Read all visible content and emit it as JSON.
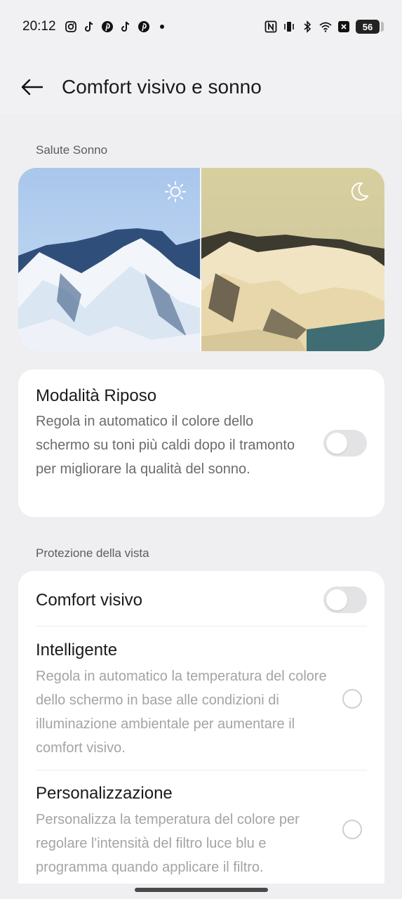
{
  "status_bar": {
    "time": "20:12",
    "battery": "56",
    "left_icons": [
      "instagram-icon",
      "tiktok-icon",
      "pinterest-icon",
      "tiktok-icon",
      "pinterest-icon",
      "dot-icon"
    ],
    "right_icons": [
      "nfc-icon",
      "vibrate-icon",
      "bluetooth-icon",
      "wifi-icon",
      "no-sim-icon"
    ]
  },
  "header": {
    "title": "Comfort visivo e sonno"
  },
  "sleep_section": {
    "label": "Salute Sonno",
    "day_icon": "sun-icon",
    "night_icon": "moon-icon"
  },
  "rest_mode": {
    "title": "Modalità Riposo",
    "description": "Regola in automatico il colore dello schermo su toni più caldi dopo il tramonto per migliorare la qualità del sonno.",
    "enabled": false
  },
  "eye_section": {
    "label": "Protezione della vista"
  },
  "eye_comfort": {
    "title": "Comfort visivo",
    "enabled": false,
    "options": [
      {
        "title": "Intelligente",
        "description": "Regola in automatico la temperatura del colore dello schermo in base alle condizioni di illuminazione ambientale per aumentare il comfort visivo.",
        "selected": false
      },
      {
        "title": "Personalizzazione",
        "description": "Personalizza la temperatura del colore per regolare l'intensità del filtro luce blu e programma quando applicare il filtro.",
        "selected": false
      }
    ]
  },
  "colors": {
    "background": "#efeff1",
    "card": "#ffffff",
    "toggle_off": "#e3e3e6"
  }
}
